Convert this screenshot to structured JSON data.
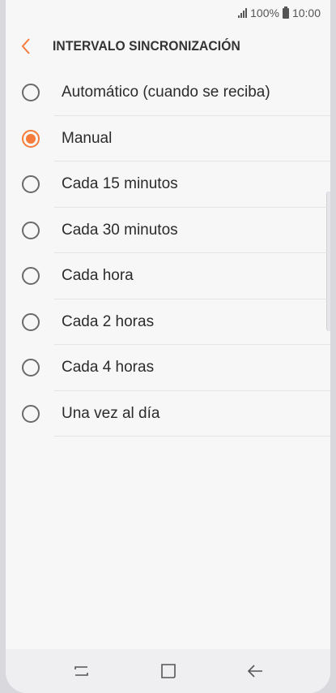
{
  "status_bar": {
    "battery_text": "100%",
    "time": "10:00"
  },
  "header": {
    "back_icon": "chevron-left-icon",
    "title": "INTERVALO SINCRONIZACIÓN",
    "accent_color": "#f57c3a"
  },
  "options": [
    {
      "label": "Automático (cuando se reciba)",
      "selected": false
    },
    {
      "label": "Manual",
      "selected": true
    },
    {
      "label": "Cada 15 minutos",
      "selected": false
    },
    {
      "label": "Cada 30 minutos",
      "selected": false
    },
    {
      "label": "Cada hora",
      "selected": false
    },
    {
      "label": "Cada 2 horas",
      "selected": false
    },
    {
      "label": "Cada 4 horas",
      "selected": false
    },
    {
      "label": "Una vez al día",
      "selected": false
    }
  ],
  "nav_bar": {
    "recents_icon": "recents-icon",
    "home_icon": "home-icon",
    "back_icon": "back-arrow-icon"
  }
}
